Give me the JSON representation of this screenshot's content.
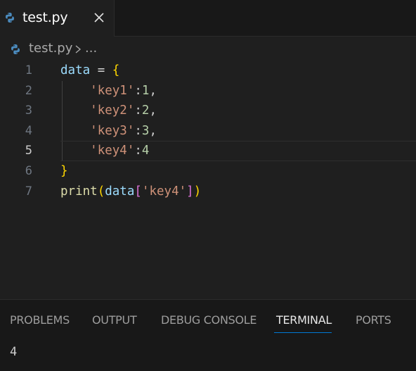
{
  "tab": {
    "title": "test.py",
    "icon": "python-icon",
    "close_icon": "close-icon"
  },
  "breadcrumb": {
    "file": "test.py",
    "more": "..."
  },
  "editor": {
    "active_line": 5,
    "line_numbers": [
      "1",
      "2",
      "3",
      "4",
      "5",
      "6",
      "7"
    ],
    "code": {
      "l1": {
        "var": "data",
        "eq": " = ",
        "open": "{"
      },
      "l2": {
        "indent": "    ",
        "key": "'key1'",
        "colon": ":",
        "val": "1",
        "comma": ","
      },
      "l3": {
        "indent": "    ",
        "key": "'key2'",
        "colon": ":",
        "val": "2",
        "comma": ","
      },
      "l4": {
        "indent": "    ",
        "key": "'key3'",
        "colon": ":",
        "val": "3",
        "comma": ","
      },
      "l5": {
        "indent": "    ",
        "key": "'key4'",
        "colon": ":",
        "val": "4"
      },
      "l6": {
        "close": "}"
      },
      "l7": {
        "fn": "print",
        "p_open": "(",
        "var": "data",
        "b_open": "[",
        "key": "'key4'",
        "b_close": "]",
        "p_close": ")"
      }
    }
  },
  "panel": {
    "tabs": [
      "PROBLEMS",
      "OUTPUT",
      "DEBUG CONSOLE",
      "TERMINAL",
      "PORTS"
    ],
    "active_tab": "TERMINAL",
    "terminal_output": "4"
  },
  "colors": {
    "background": "#1f1f1f",
    "accent": "#0078d4",
    "string": "#ce9178",
    "number": "#b5cea8",
    "variable": "#9cdcfe",
    "function": "#dcdcaa",
    "bracket_level1": "#ffd700",
    "bracket_level2": "#da70d6",
    "bracket_level3": "#179fff"
  }
}
